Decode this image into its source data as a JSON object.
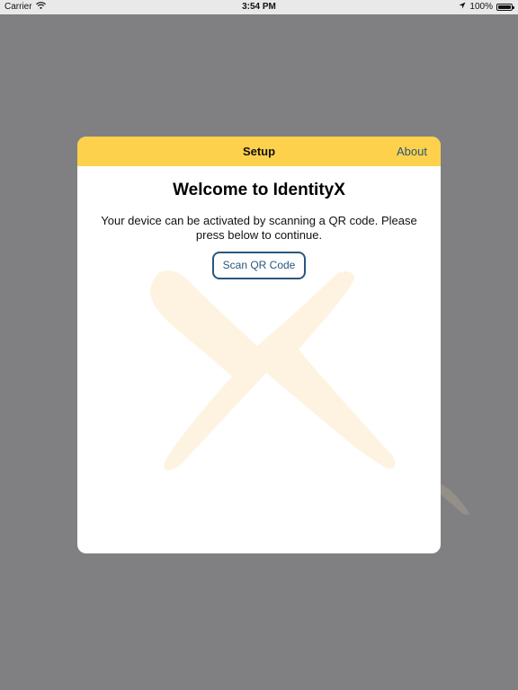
{
  "status_bar": {
    "carrier": "Carrier",
    "time": "3:54 PM",
    "battery": "100%",
    "battery_level": 1.0
  },
  "modal": {
    "title": "Setup",
    "about_label": "About",
    "heading": "Welcome to IdentityX",
    "description": "Your device can be activated by scanning a QR code. Please press below to continue.",
    "scan_button_label": "Scan QR Code"
  },
  "colors": {
    "header_bg": "#fdd14b",
    "accent": "#28577e",
    "overlay": "#808083",
    "watermark": "#fdf3e0"
  },
  "icons": [
    "wifi-icon",
    "location-arrow-icon",
    "battery-icon",
    "identityx-x-logo"
  ]
}
